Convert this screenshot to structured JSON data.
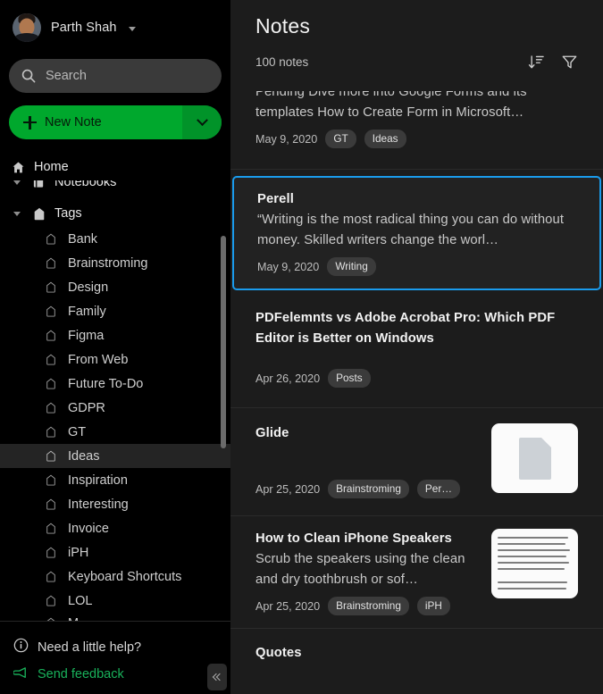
{
  "sidebar": {
    "account": {
      "name": "Parth Shah",
      "avatar": "user-avatar",
      "caret": "chevron-down-icon"
    },
    "search": {
      "placeholder": "Search",
      "icon": "search-icon"
    },
    "new_note": {
      "label": "New Note",
      "icon": "plus-icon",
      "dropdown_icon": "chevron-down-icon",
      "color": "#00a82d"
    },
    "nav": [
      {
        "label": "Home",
        "icon": "home-icon",
        "level": "top"
      },
      {
        "label": "Notebooks",
        "icon": "notebook-icon",
        "level": "top",
        "clipped": true
      },
      {
        "label": "Tags",
        "icon": "tag-icon",
        "level": "top",
        "expanded": true
      }
    ],
    "tags": [
      {
        "label": "Bank"
      },
      {
        "label": "Brainstroming"
      },
      {
        "label": "Design"
      },
      {
        "label": "Family"
      },
      {
        "label": "Figma"
      },
      {
        "label": "From Web"
      },
      {
        "label": "Future To-Do"
      },
      {
        "label": "GDPR"
      },
      {
        "label": "GT"
      },
      {
        "label": "Ideas",
        "selected": true
      },
      {
        "label": "Inspiration"
      },
      {
        "label": "Interesting"
      },
      {
        "label": "Invoice"
      },
      {
        "label": "iPH"
      },
      {
        "label": "Keyboard Shortcuts"
      },
      {
        "label": "LOL"
      },
      {
        "label": "M",
        "clipped": true
      }
    ],
    "footer": {
      "help_label": "Need a little help?",
      "help_icon": "info-circle-icon",
      "feedback_label": "Send feedback",
      "feedback_icon": "megaphone-icon",
      "feedback_color": "#19b25b",
      "collapse_icon": "double-chevron-left-icon"
    }
  },
  "notes_panel": {
    "title": "Notes",
    "count_label": "100 notes",
    "sort_icon": "sort-descending-icon",
    "filter_icon": "filter-funnel-icon",
    "selection_color": "#1a9bec",
    "notes": [
      {
        "title": "",
        "snippet": "Pending Dive more into Google Forms and its templates How to Create Form in Microsoft…",
        "date": "May 9, 2020",
        "tags": [
          "GT",
          "Ideas"
        ],
        "thumbnail": null,
        "clipped": true
      },
      {
        "title": "Perell",
        "snippet": "“Writing is the most radical thing you can do without money. Skilled writers change the worl…",
        "date": "May 9, 2020",
        "tags": [
          "Writing"
        ],
        "thumbnail": null,
        "selected": true
      },
      {
        "title": "PDFelemnts vs Adobe Acrobat Pro: Which PDF Editor is Better on Windows",
        "snippet": "",
        "date": "Apr 26, 2020",
        "tags": [
          "Posts"
        ],
        "thumbnail": null
      },
      {
        "title": "Glide",
        "snippet": "",
        "date": "Apr 25, 2020",
        "tags": [
          "Brainstroming",
          "Per…"
        ],
        "thumbnail": "document-placeholder"
      },
      {
        "title": "How to Clean iPhone Speakers",
        "snippet": "Scrub the speakers using the clean and dry toothbrush or sof…",
        "date": "Apr 25, 2020",
        "tags": [
          "Brainstroming",
          "iPH"
        ],
        "thumbnail": "text-page"
      },
      {
        "title": "Quotes",
        "snippet": "",
        "date": "",
        "tags": [],
        "thumbnail": null,
        "partial": true
      }
    ]
  }
}
